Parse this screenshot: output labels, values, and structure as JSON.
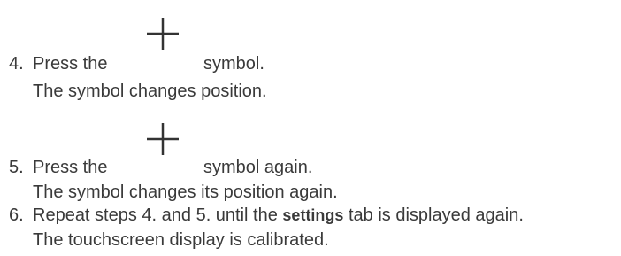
{
  "steps": [
    {
      "number": "4.",
      "text_before_icon": "Press the",
      "icon": "plus-icon",
      "text_after_icon": "symbol.",
      "result": "The symbol changes position."
    },
    {
      "number": "5.",
      "text_before_icon": "Press the",
      "icon": "plus-icon",
      "text_after_icon": "symbol again.",
      "result": "The symbol changes its position again."
    },
    {
      "number": "6.",
      "text_before": "Repeat steps 4. and 5. until the",
      "text_bold": "settings",
      "text_after": "tab is displayed again.",
      "result": "The touchscreen display is calibrated."
    }
  ]
}
